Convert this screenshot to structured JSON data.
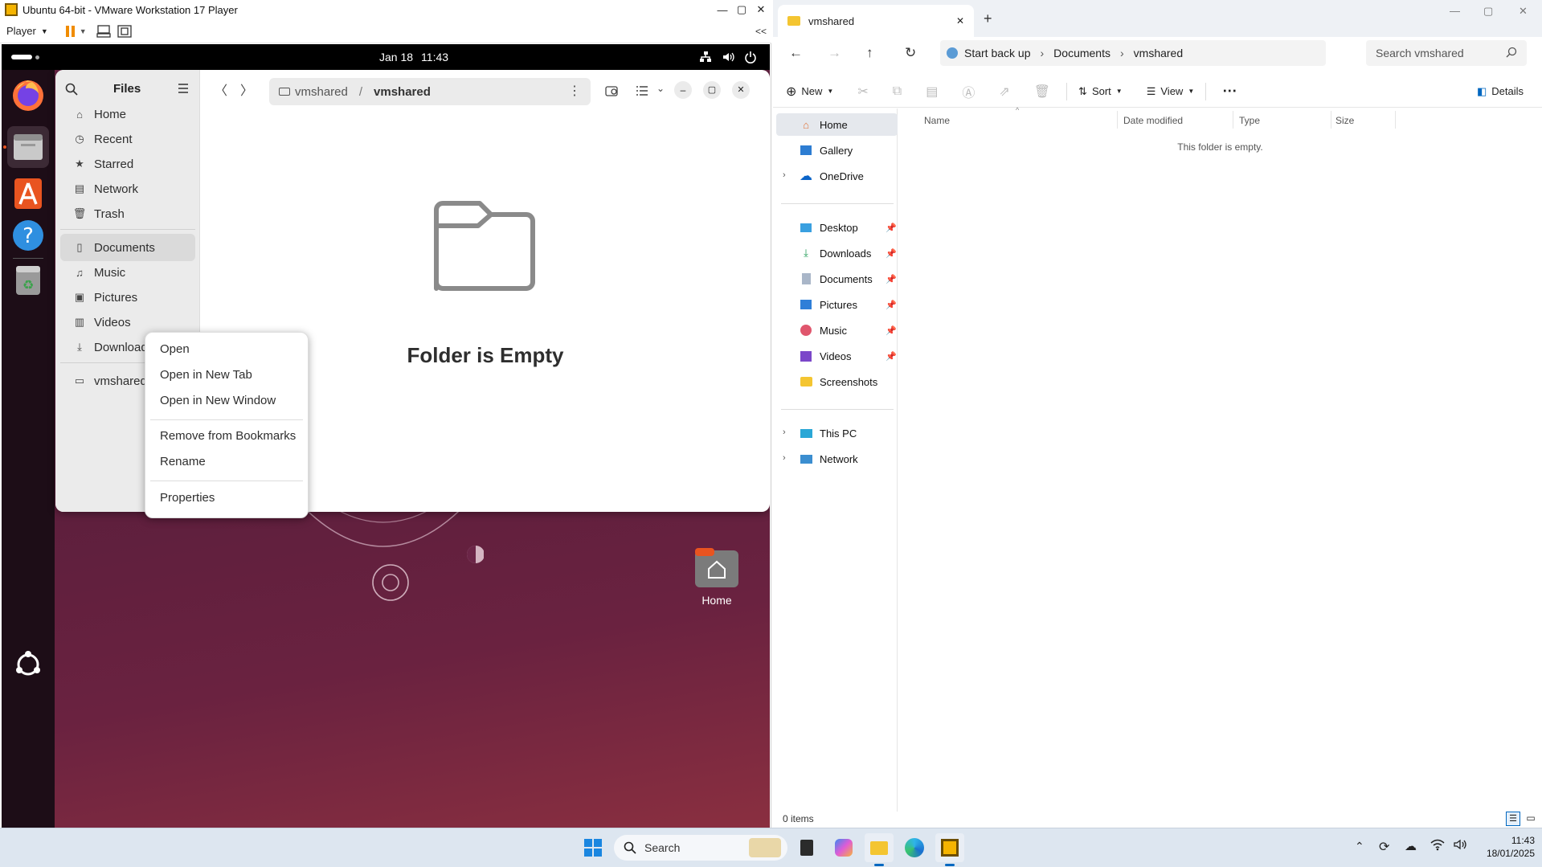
{
  "vmware": {
    "title": "Ubuntu 64-bit - VMware Workstation 17 Player",
    "player_menu": "Player",
    "collapse": "<<"
  },
  "ubuntu": {
    "topbar": {
      "date": "Jan 18",
      "time": "11:43"
    },
    "dock": [
      {
        "name": "firefox-icon"
      },
      {
        "name": "files-icon"
      },
      {
        "name": "app-center-icon"
      },
      {
        "name": "help-icon"
      },
      {
        "name": "trash-icon"
      }
    ],
    "desktop_icon_label": "Home"
  },
  "files": {
    "header_title": "Files",
    "path_parent": "vmshared",
    "path_current": "vmshared",
    "empty_message": "Folder is Empty",
    "sidebar": [
      {
        "label": "Home",
        "icon": "home-icon"
      },
      {
        "label": "Recent",
        "icon": "clock-icon"
      },
      {
        "label": "Starred",
        "icon": "star-icon"
      },
      {
        "label": "Network",
        "icon": "network-icon"
      },
      {
        "label": "Trash",
        "icon": "trash-icon"
      },
      {
        "label": "Documents",
        "icon": "document-icon"
      },
      {
        "label": "Music",
        "icon": "music-icon"
      },
      {
        "label": "Pictures",
        "icon": "pictures-icon"
      },
      {
        "label": "Videos",
        "icon": "videos-icon"
      },
      {
        "label": "Downloads",
        "icon": "download-icon"
      },
      {
        "label": "vmshared",
        "icon": "drive-icon"
      }
    ],
    "context_menu": [
      "Open",
      "Open in New Tab",
      "Open in New Window",
      "Remove from Bookmarks",
      "Rename",
      "Properties"
    ]
  },
  "explorer": {
    "tab_title": "vmshared",
    "backup_label": "Start back up",
    "breadcrumb": [
      "Documents",
      "vmshared"
    ],
    "search_placeholder": "Search vmshared",
    "commands": {
      "new": "New",
      "sort": "Sort",
      "view": "View",
      "details": "Details"
    },
    "sidebar_top": [
      "Home",
      "Gallery",
      "OneDrive"
    ],
    "quick_access": [
      "Desktop",
      "Downloads",
      "Documents",
      "Pictures",
      "Music",
      "Videos",
      "Screenshots"
    ],
    "sidebar_bottom": [
      "This PC",
      "Network"
    ],
    "columns": [
      "Name",
      "Date modified",
      "Type",
      "Size"
    ],
    "empty_text": "This folder is empty.",
    "status": "0 items"
  },
  "taskbar": {
    "search_label": "Search",
    "time": "11:43",
    "date": "18/01/2025"
  },
  "colors": {
    "ubuntu_orange": "#e95420",
    "win_accent": "#0067c0",
    "desktop": "#5a1e3c"
  }
}
